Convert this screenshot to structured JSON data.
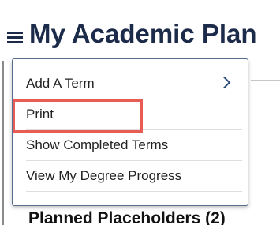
{
  "header": {
    "title": "My Academic Plan",
    "menu_icon": "hamburger-menu-icon"
  },
  "menu": {
    "items": [
      {
        "label": "Add A Term",
        "icon": "chevron-right-icon"
      },
      {
        "label": "Print"
      },
      {
        "label": "Show Completed Terms"
      },
      {
        "label": "View My Degree Progress"
      }
    ]
  },
  "background": {
    "section_heading": "Planned Placeholders (2)"
  },
  "colors": {
    "title": "#1c2b4a",
    "menu_border": "#5a6f8f",
    "chevron": "#2e4d7a",
    "highlight": "#e85c56"
  }
}
